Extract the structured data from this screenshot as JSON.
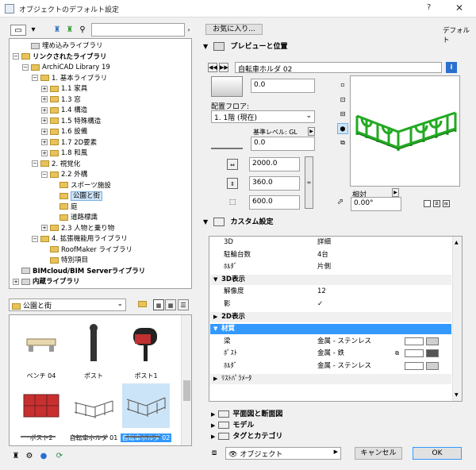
{
  "window": {
    "title": "オブジェクトのデフォルト設定",
    "help": "?",
    "close": "✕"
  },
  "left_toolbar": {
    "search_value": "",
    "search_icon": "magnifier-icon"
  },
  "tree": [
    {
      "label": "埋め込みライブラリ",
      "level": 1,
      "bold": false,
      "exp": "",
      "icon": "gray"
    },
    {
      "label": "リンクされたライブラリ",
      "level": 0,
      "bold": true,
      "exp": "−",
      "icon": "gold"
    },
    {
      "label": "ArchiCAD Library 19",
      "level": 1,
      "bold": false,
      "exp": "−",
      "icon": "gold"
    },
    {
      "label": "1. 基本ライブラリ",
      "level": 2,
      "bold": false,
      "exp": "−",
      "icon": "gold"
    },
    {
      "label": "1.1 家具",
      "level": 3,
      "bold": false,
      "exp": "+",
      "icon": "gold"
    },
    {
      "label": "1.3 窓",
      "level": 3,
      "bold": false,
      "exp": "+",
      "icon": "gold"
    },
    {
      "label": "1.4 構造",
      "level": 3,
      "bold": false,
      "exp": "+",
      "icon": "gold"
    },
    {
      "label": "1.5 特殊構造",
      "level": 3,
      "bold": false,
      "exp": "+",
      "icon": "gold"
    },
    {
      "label": "1.6 設備",
      "level": 3,
      "bold": false,
      "exp": "+",
      "icon": "gold"
    },
    {
      "label": "1.7 2D要素",
      "level": 3,
      "bold": false,
      "exp": "+",
      "icon": "gold"
    },
    {
      "label": "1.8 和風",
      "level": 3,
      "bold": false,
      "exp": "+",
      "icon": "gold"
    },
    {
      "label": "2. 視覚化",
      "level": 2,
      "bold": false,
      "exp": "−",
      "icon": "gold"
    },
    {
      "label": "2.2 外構",
      "level": 3,
      "bold": false,
      "exp": "−",
      "icon": "gold"
    },
    {
      "label": "スポーツ施設",
      "level": 4,
      "bold": false,
      "exp": "",
      "icon": "gold"
    },
    {
      "label": "公園と街",
      "level": 4,
      "bold": false,
      "exp": "",
      "icon": "gold",
      "selected": true
    },
    {
      "label": "庭",
      "level": 4,
      "bold": false,
      "exp": "",
      "icon": "gold"
    },
    {
      "label": "道路標識",
      "level": 4,
      "bold": false,
      "exp": "",
      "icon": "gold"
    },
    {
      "label": "2.3 人物と乗り物",
      "level": 3,
      "bold": false,
      "exp": "+",
      "icon": "gold"
    },
    {
      "label": "4. 拡張機能用ライブラリ",
      "level": 2,
      "bold": false,
      "exp": "−",
      "icon": "gold"
    },
    {
      "label": "RoofMaker ライブラリ",
      "level": 3,
      "bold": false,
      "exp": "",
      "icon": "gold"
    },
    {
      "label": "特別項目",
      "level": 3,
      "bold": false,
      "exp": "",
      "icon": "gold"
    },
    {
      "label": "BIMcloud/BIM Serverライブラリ",
      "level": 0,
      "bold": true,
      "exp": "",
      "icon": "gray"
    },
    {
      "label": "内蔵ライブラリ",
      "level": 0,
      "bold": true,
      "exp": "+",
      "icon": "gray"
    }
  ],
  "folder_dropdown": {
    "value": "公園と街"
  },
  "thumbnails": [
    {
      "label": "ベンチ 04",
      "kind": "bench"
    },
    {
      "label": "ポスト",
      "kind": "post"
    },
    {
      "label": "ポスト1",
      "kind": "mailbox"
    },
    {
      "label": "ポスト2",
      "kind": "cabinet"
    },
    {
      "label": "自転車ホルダ 01",
      "kind": "rack1"
    },
    {
      "label": "自転車ホルダ 02",
      "kind": "rack2",
      "selected": true
    }
  ],
  "right": {
    "favorites_button": "お気に入り...",
    "default_label": "デフォルト",
    "preview_header": "プレビューと位置",
    "object_name": "自転車ホルダ 02",
    "offset_value": "0.0",
    "floor_label": "配置フロア:",
    "floor_value": "1. 1階 (現在)",
    "ref_level_label": "基準レベル: GL",
    "ref_value": "0.0",
    "width_value": "2000.0",
    "depth_value": "360.0",
    "height_value": "600.0",
    "relative_label": "相対",
    "angle_value": "0.00°",
    "custom_header": "カスタム設定",
    "props": [
      {
        "k": "3D",
        "v": "詳細"
      },
      {
        "k": "駐輪台数",
        "v": "4台"
      },
      {
        "k": "ﾎﾙﾀﾞ",
        "v": "片側"
      }
    ],
    "group_3d": "3D表示",
    "props_3d": [
      {
        "k": "解像度",
        "v": "12"
      },
      {
        "k": "影",
        "v": "✓"
      }
    ],
    "group_2d": "2D表示",
    "group_material": "材質",
    "materials": [
      {
        "k": "梁",
        "v": "金属 - ステンレス",
        "dark": false
      },
      {
        "k": "ﾎﾟｽﾄ",
        "v": "金属 - 鉄",
        "dark": true
      },
      {
        "k": "ﾎﾙﾀﾞ",
        "v": "金属 - ステンレス",
        "dark": false
      }
    ],
    "group_list": "ﾘｽﾄﾊﾟﾗﾒｰﾀ",
    "bottom_sections": [
      "平面図と断面図",
      "モデル",
      "タグとカテゴリ"
    ],
    "layer_value": "オブジェクト",
    "cancel_label": "キャンセル",
    "ok_label": "OK"
  },
  "colors": {
    "accent": "#3399ff",
    "rack": "#22aa22",
    "selected": "#cce4f7"
  }
}
